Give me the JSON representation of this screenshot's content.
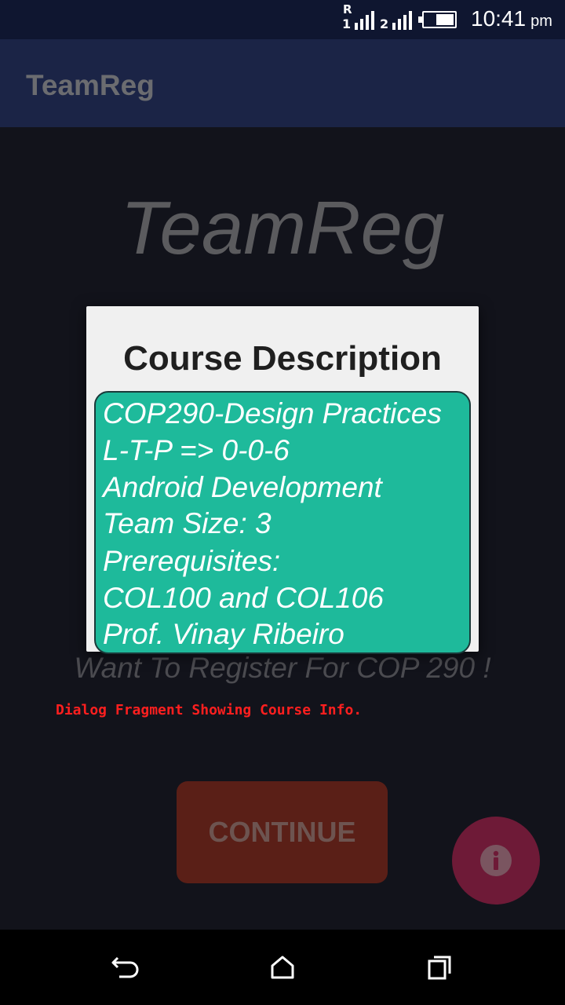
{
  "status_bar": {
    "sim1_roaming": "R",
    "sim1_label": "1",
    "sim2_label": "2",
    "time": "10:41",
    "ampm": "pm"
  },
  "app_bar": {
    "title": "TeamReg"
  },
  "main": {
    "hero_title": "TeamReg",
    "register_prompt": "Want To Register For COP 290 !",
    "caption": "Dialog Fragment Showing Course Info.",
    "continue_label": "CONTINUE",
    "fab_icon": "info-icon"
  },
  "dialog": {
    "title": "Course Description",
    "lines": [
      " COP290-Design Practices",
      "L-T-P => 0-0-6",
      "Android Development",
      "Team Size: 3",
      "Prerequisites:",
      "COL100 and COL106",
      "Prof. Vinay Ribeiro"
    ]
  },
  "nav_bar": {
    "icons": [
      "back-icon",
      "home-icon",
      "recents-icon"
    ]
  },
  "colors": {
    "status_bar": "#0f1630",
    "app_bar": "#1b2446",
    "info_box": "#1eba9b",
    "caption": "#ff1f1f",
    "continue_button": "#5a1f17",
    "fab": "#6e1a37"
  }
}
